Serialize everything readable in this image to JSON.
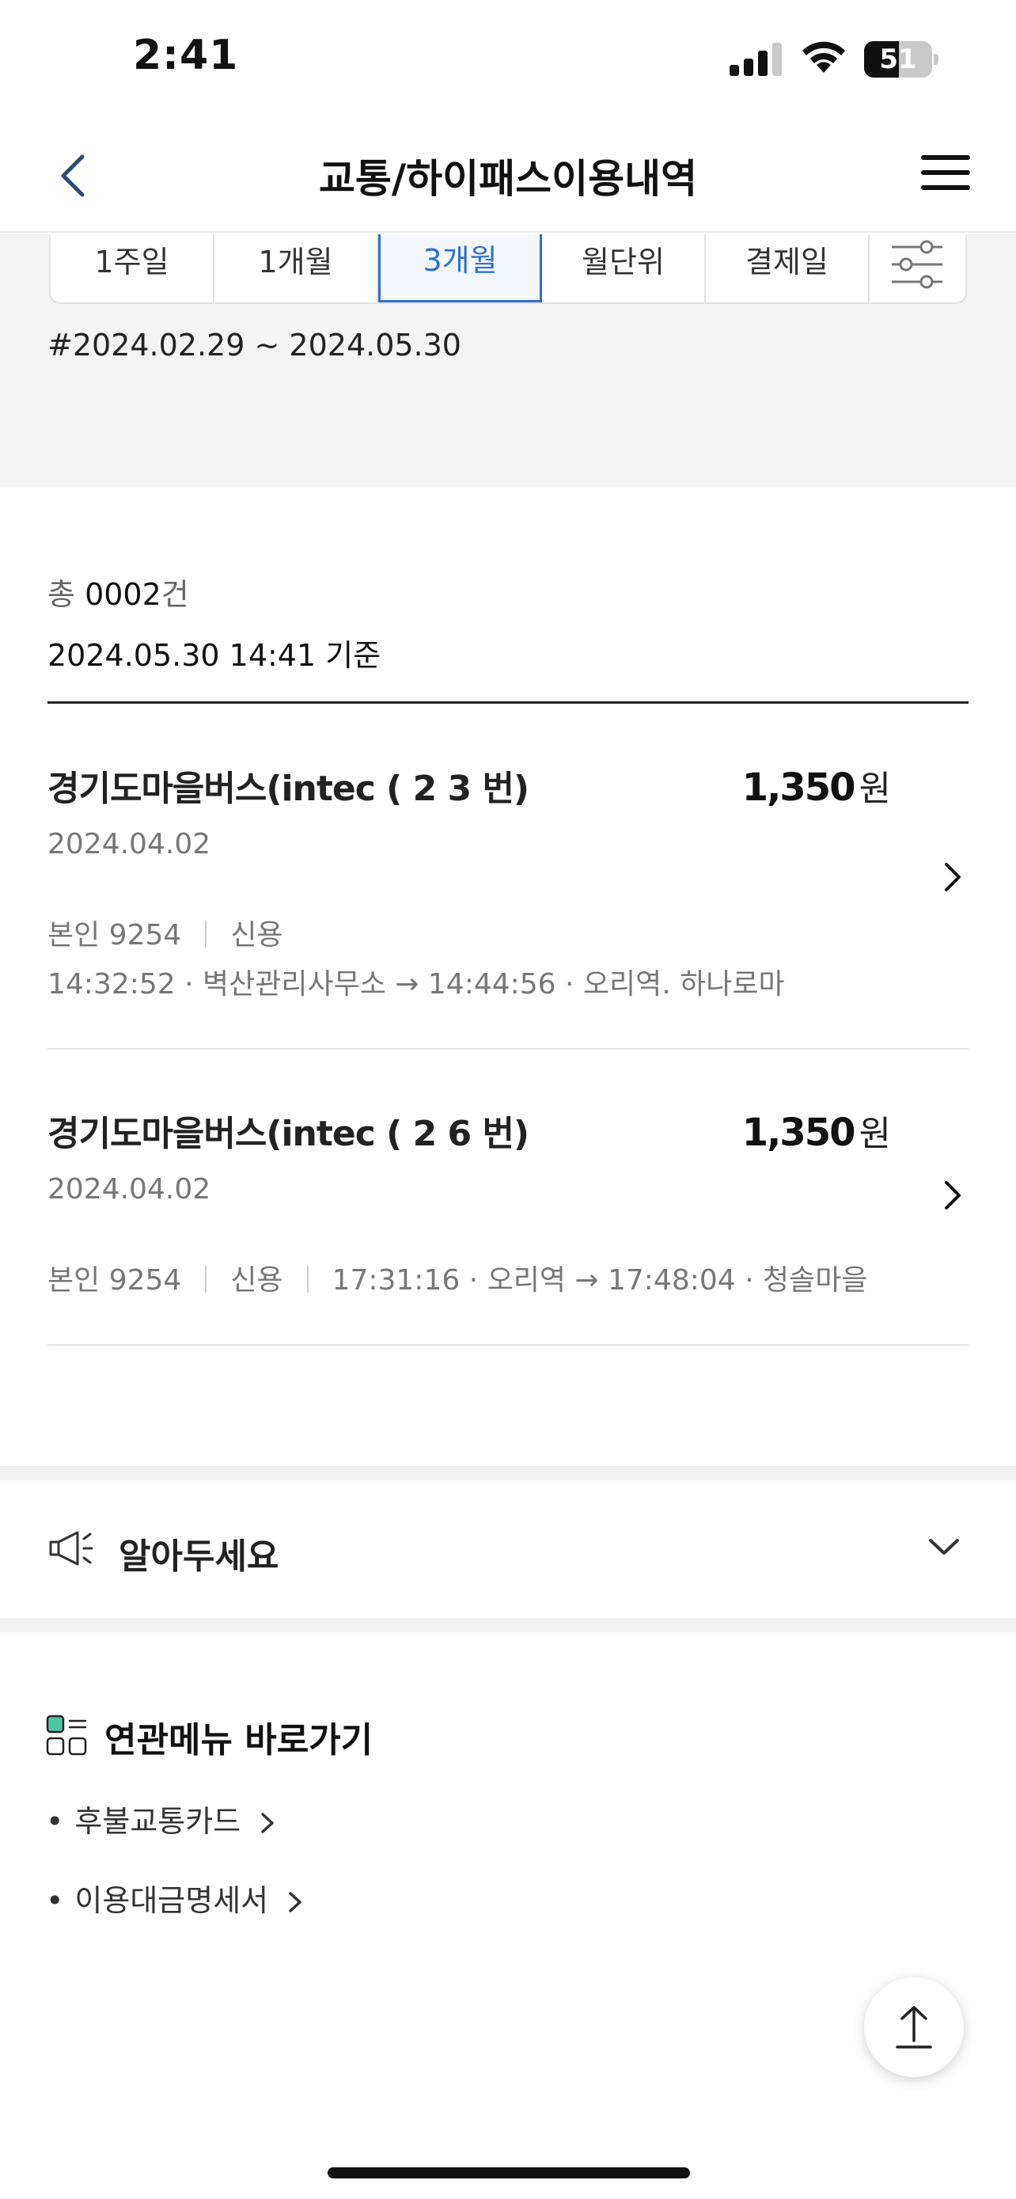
{
  "status_bar": {
    "time": "2:41",
    "battery_percent": 51,
    "battery_label": "51"
  },
  "nav": {
    "title": "교통/하이패스이용내역"
  },
  "filter": {
    "tabs": [
      {
        "label": "1주일",
        "active": false
      },
      {
        "label": "1개월",
        "active": false
      },
      {
        "label": "3개월",
        "active": true
      },
      {
        "label": "월단위",
        "active": false
      },
      {
        "label": "결제일",
        "active": false
      }
    ],
    "date_range": "#2024.02.29 ~ 2024.05.30",
    "active_color": "#2f6fce"
  },
  "summary": {
    "total_prefix": "총",
    "total_count": "0002",
    "total_suffix": "건",
    "as_of": "2024.05.30 14:41 기준"
  },
  "transactions": [
    {
      "title": "경기도마을버스(intec ( 2  3 번)",
      "amount": "1,350",
      "unit": "원",
      "date": "2024.04.02",
      "owner": "본인 9254",
      "type": "신용",
      "route": "14:32:52 · 벽산관리사무소 → 14:44:56 · 오리역.  하나로마"
    },
    {
      "title": "경기도마을버스(intec ( 2  6 번)",
      "amount": "1,350",
      "unit": "원",
      "date": "2024.04.02",
      "owner": "본인 9254",
      "type": "신용",
      "route": "17:31:16 · 오리역 → 17:48:04 · 청솔마을"
    }
  ],
  "notice": {
    "title": "알아두세요",
    "icon": "megaphone-icon"
  },
  "related": {
    "title": "연관메뉴 바로가기",
    "icon": "menu-grid-icon",
    "links": [
      {
        "label": "후불교통카드"
      },
      {
        "label": "이용대금명세서"
      }
    ]
  }
}
